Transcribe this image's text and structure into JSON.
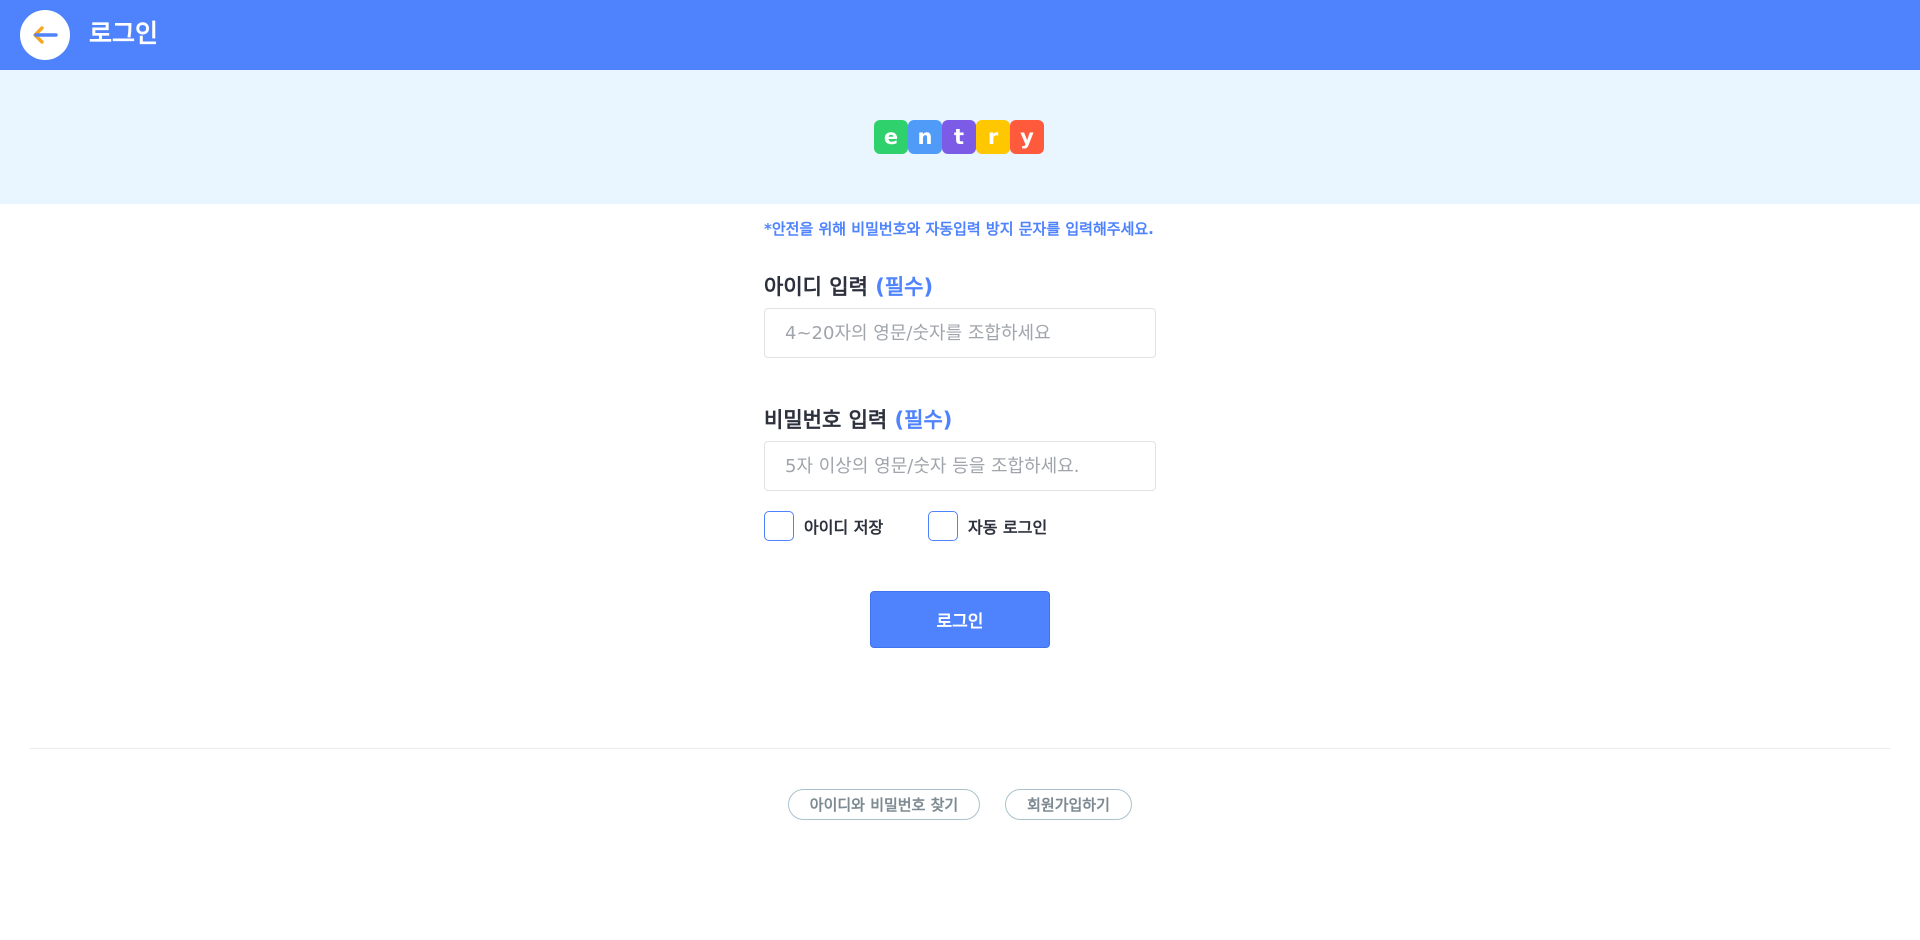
{
  "header": {
    "title": "로그인",
    "back_icon": "arrow-left-icon",
    "color": "#4f83fd"
  },
  "logo": {
    "letters": [
      {
        "char": "e",
        "color": "#2ed16b"
      },
      {
        "char": "n",
        "color": "#4f9bf7"
      },
      {
        "char": "t",
        "color": "#7c5ce6"
      },
      {
        "char": "r",
        "color": "#ffc700"
      },
      {
        "char": "y",
        "color": "#ff5a3c"
      }
    ]
  },
  "form": {
    "notice": "*안전을 위해 비밀번호와 자동입력 방지 문자를 입력해주세요.",
    "id_label": "아이디 입력",
    "id_required": "(필수)",
    "id_placeholder": "4~20자의 영문/숫자를 조합하세요",
    "password_label": "비밀번호 입력",
    "password_required": "(필수)",
    "password_placeholder": "5자 이상의 영문/숫자 등을 조합하세요.",
    "save_id_label": "아이디 저장",
    "auto_login_label": "자동 로그인",
    "login_button": "로그인"
  },
  "footer": {
    "find_account": "아이디와 비밀번호 찾기",
    "signup": "회원가입하기"
  }
}
